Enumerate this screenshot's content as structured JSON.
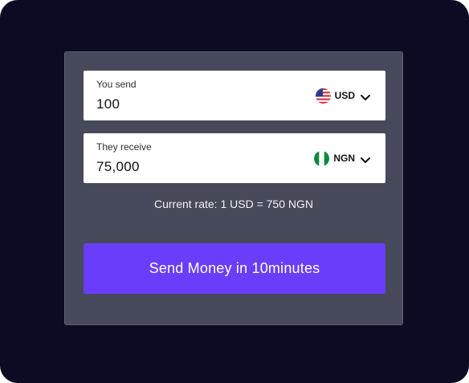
{
  "send_field": {
    "label": "You send",
    "value": "100",
    "currency": "USD",
    "flag_icon": "us-flag-icon"
  },
  "receive_field": {
    "label": "They receive",
    "value": "75,000",
    "currency": "NGN",
    "flag_icon": "ng-flag-icon"
  },
  "rate_text": "Current rate: 1 USD = 750 NGN",
  "send_button_label": "Send Money in 10minutes",
  "colors": {
    "page_background": "#0b0b24",
    "card": "#474a5b",
    "accent": "#6a3dfa"
  }
}
